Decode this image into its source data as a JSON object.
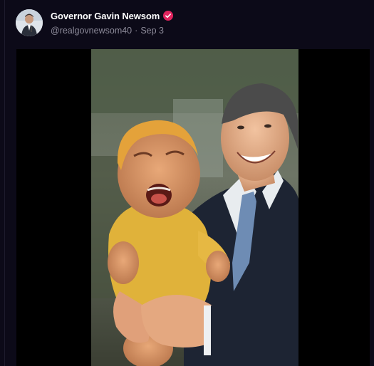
{
  "post": {
    "author": {
      "display_name": "Governor Gavin Newsom",
      "handle": "@realgovnewsom40",
      "verified": true,
      "verified_badge_color": "#e0245e",
      "avatar_icon": "person-avatar"
    },
    "separator": "·",
    "date": "Sep 3",
    "media": {
      "type": "image",
      "icon": "photo-image"
    }
  },
  "colors": {
    "background": "#0c0a18",
    "name": "#ffffff",
    "meta": "#8d8b9a",
    "media_letterbox": "#000000"
  }
}
